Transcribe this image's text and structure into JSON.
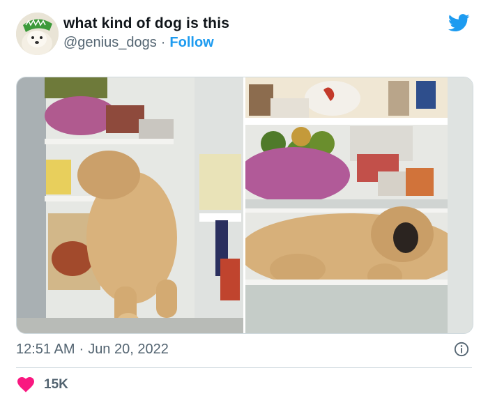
{
  "tweet": {
    "author": {
      "display_name": "what kind of dog is this",
      "handle": "@genius_dogs",
      "follow_label": "Follow",
      "separator": "·"
    },
    "icons": {
      "brand": "twitter-bird-icon",
      "info": "info-icon",
      "like": "heart-icon"
    },
    "colors": {
      "brand_blue": "#1d9bf0",
      "like_red": "#f91880",
      "secondary_text": "#536471"
    },
    "media": [
      {
        "description_name": "puppy-head-in-fridge-photo"
      },
      {
        "description_name": "puppy-sleeping-in-fridge-photo"
      }
    ],
    "meta": {
      "time": "12:51 AM",
      "separator": "·",
      "date": "Jun 20, 2022"
    },
    "engagement": {
      "likes": "15K"
    }
  }
}
